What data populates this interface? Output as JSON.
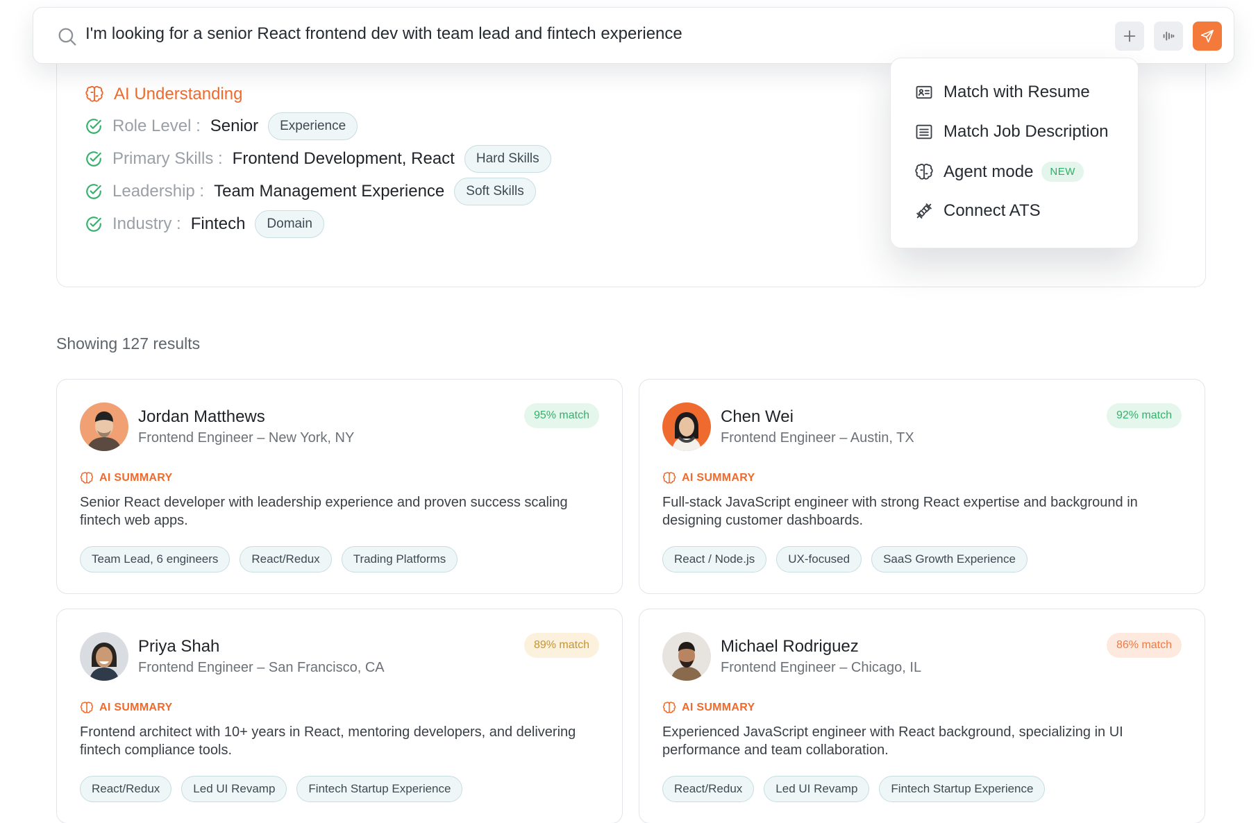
{
  "search": {
    "query": "I'm looking for a senior React frontend dev with team lead and fintech experience",
    "buttons": {
      "add": "plus-icon",
      "voice": "waveform-icon",
      "send": "send-icon"
    }
  },
  "ai_understanding": {
    "title": "AI Understanding",
    "criteria": [
      {
        "key": "Role Level :",
        "value": "Senior",
        "tag": "Experience"
      },
      {
        "key": "Primary Skills :",
        "value": "Frontend Development, React",
        "tag": "Hard Skills"
      },
      {
        "key": "Leadership :",
        "value": "Team Management Experience",
        "tag": "Soft Skills"
      },
      {
        "key": "Industry :",
        "value": "Fintech",
        "tag": "Domain"
      }
    ]
  },
  "menu": {
    "items": [
      {
        "label": "Match with Resume",
        "icon": "id-card-icon"
      },
      {
        "label": "Match Job Description",
        "icon": "document-lines-icon"
      },
      {
        "label": "Agent mode",
        "icon": "brain-icon",
        "badge": "NEW"
      },
      {
        "label": "Connect ATS",
        "icon": "plug-icon"
      }
    ]
  },
  "results": {
    "count_label": "Showing 127 results",
    "summary_label": "AI SUMMARY",
    "candidates": [
      {
        "name": "Jordan Matthews",
        "role": "Frontend Engineer – New York, NY",
        "match": "95% match",
        "summary": "Senior React developer with leadership experience and proven success scaling fintech web apps.",
        "tags": [
          "Team Lead, 6 engineers",
          "React/Redux",
          "Trading Platforms"
        ]
      },
      {
        "name": "Chen Wei",
        "role": "Frontend Engineer – Austin, TX",
        "match": "92% match",
        "summary": "Full-stack JavaScript engineer with strong React expertise and background in designing customer dashboards.",
        "tags": [
          "React / Node.js",
          "UX-focused",
          "SaaS Growth Experience"
        ]
      },
      {
        "name": "Priya Shah",
        "role": "Frontend Engineer – San Francisco, CA",
        "match": "89% match",
        "summary": "Frontend architect with 10+ years in React, mentoring developers, and delivering fintech compliance tools.",
        "tags": [
          "React/Redux",
          "Led UI Revamp",
          "Fintech Startup Experience"
        ]
      },
      {
        "name": "Michael Rodriguez",
        "role": "Frontend Engineer – Chicago, IL",
        "match": "86% match",
        "summary": "Experienced JavaScript engineer with React background, specializing in UI performance and team collaboration.",
        "tags": [
          "React/Redux",
          "Led UI Revamp",
          "Fintech Startup Experience"
        ]
      }
    ]
  },
  "colors": {
    "accent": "#ef6a2c",
    "send_button": "#f47a3c",
    "check_green": "#36b06c",
    "match_high": "#36b06c",
    "match_mid": "#c8942c",
    "match_low": "#ef7a43"
  }
}
